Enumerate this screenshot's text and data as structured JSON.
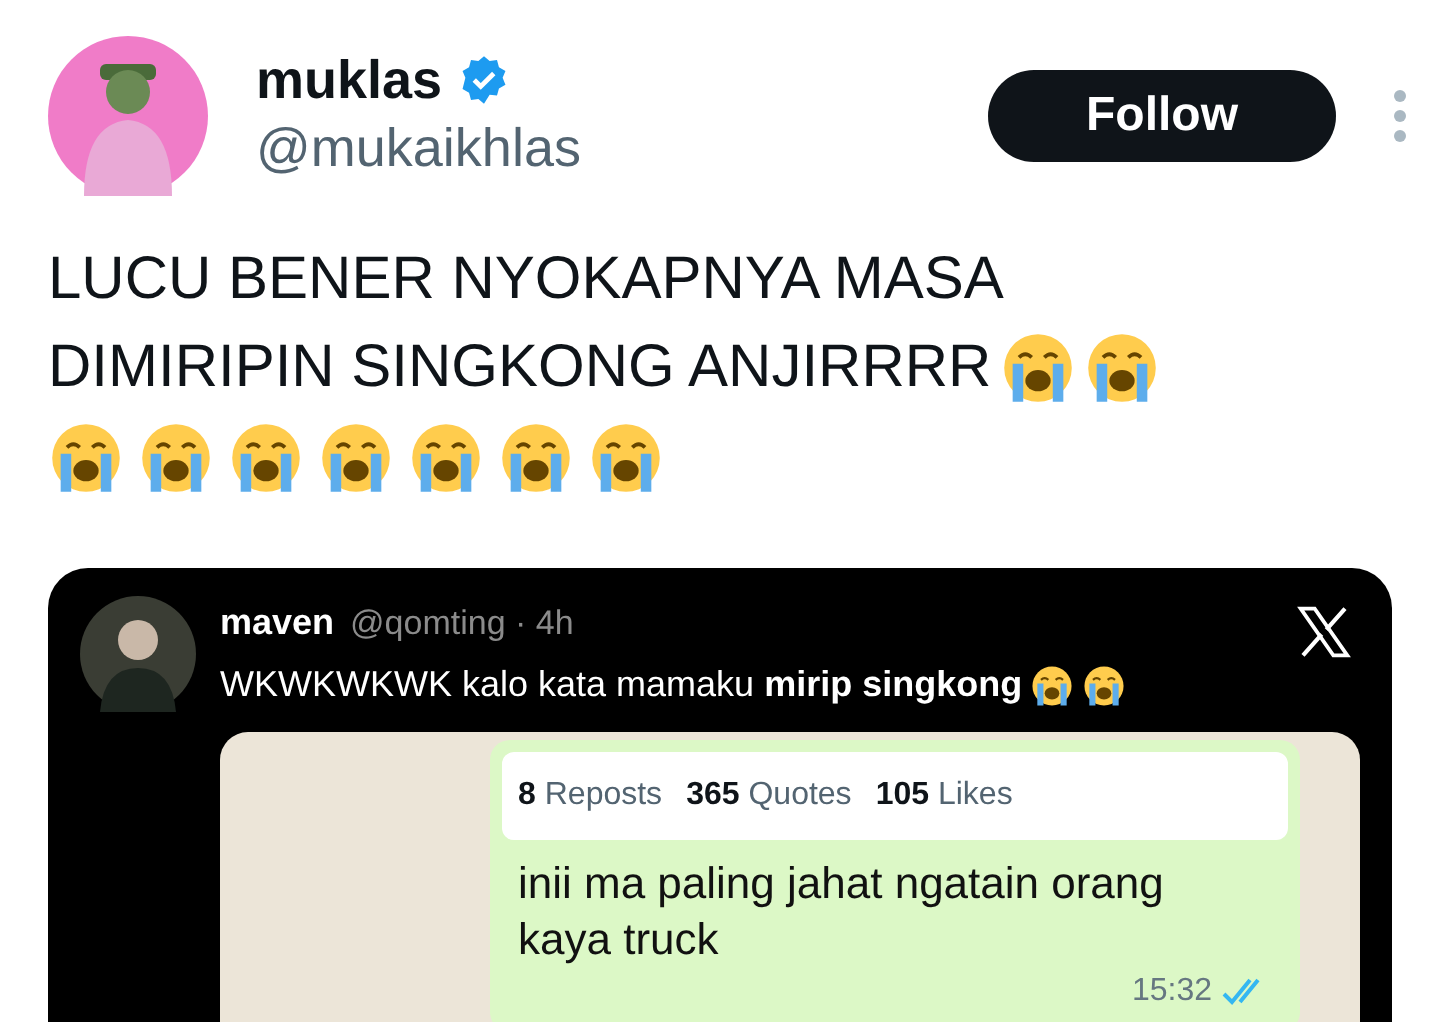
{
  "author": {
    "name": "muklas",
    "verified": true,
    "handle": "@mukaikhlas"
  },
  "follow_button": "Follow",
  "tweet_text_lines": [
    "LUCU BENER NYOKAPNYA MASA",
    "DIMIRIPIN SINGKONG ANJIRRRR"
  ],
  "quoted_post": {
    "name": "maven",
    "meta": "@qomting · 4h",
    "text": "WKWKWKWK kalo kata mamaku **mirip singkong**",
    "chat": {
      "stats": [
        {
          "count": "8",
          "label": "Reposts"
        },
        {
          "count": "365",
          "label": "Quotes"
        },
        {
          "count": "105",
          "label": "Likes"
        }
      ],
      "message": "inii ma paling jahat ngatain orang kaya truck",
      "time": "15:32",
      "read": true
    }
  }
}
